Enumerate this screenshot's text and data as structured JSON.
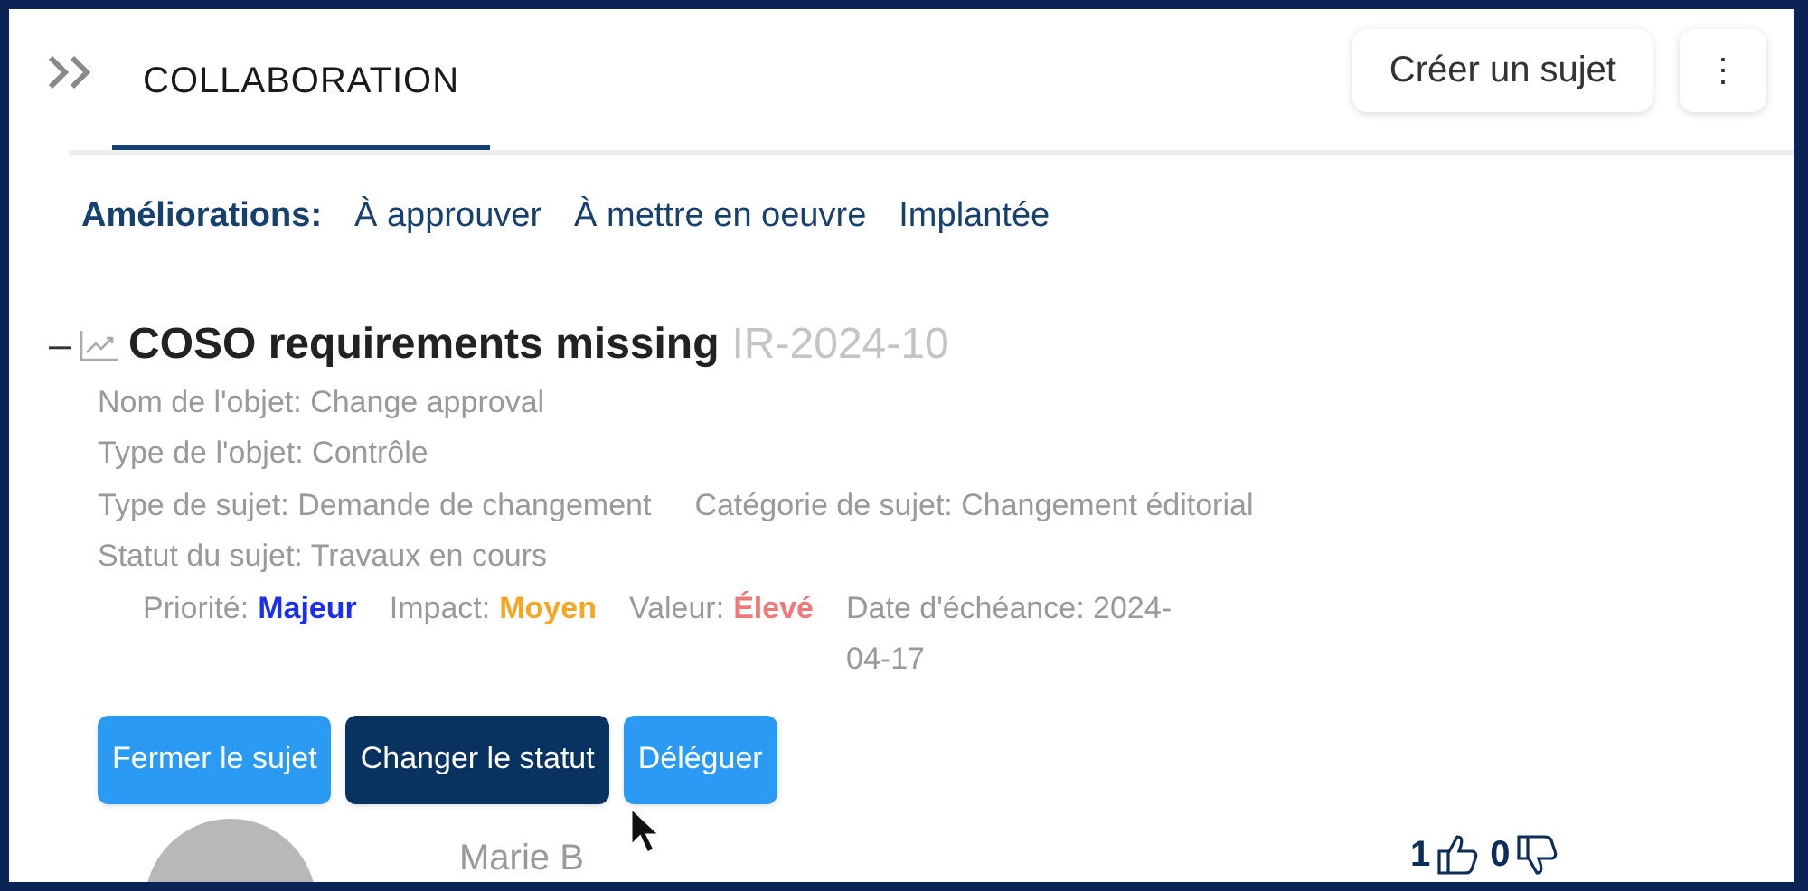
{
  "tabs": [
    {
      "label": "COLLABORATION",
      "selected": true
    }
  ],
  "header_buttons": [
    {
      "kind": "text",
      "label": "Créer un sujet"
    },
    {
      "kind": "menu",
      "label": "⋮"
    }
  ],
  "filters": {
    "label": "Améliorations:",
    "items": [
      {
        "label": "À approuver"
      },
      {
        "label": "À mettre en oeuvre"
      },
      {
        "label": "Implantée"
      }
    ]
  },
  "issue": {
    "expanded": true,
    "toggle": "–",
    "title": "COSO requirements missing",
    "id": "IR-2024-10",
    "fields": [
      [
        {
          "label": "Nom de l'objet:",
          "value": "Change approval"
        }
      ],
      [
        {
          "label": "Type de l'objet:",
          "value": "Contrôle"
        }
      ],
      [
        {
          "label": "Type de sujet:",
          "value": "Demande de changement"
        },
        {
          "label": "Catégorie de sujet:",
          "value": "Changement éditorial"
        }
      ],
      [
        {
          "label": "Statut du sujet:",
          "value": "Travaux en cours"
        }
      ]
    ],
    "meta": [
      {
        "label": "Priorité:",
        "value": "Majeur",
        "color": "#1a2ff0"
      },
      {
        "label": "Impact:",
        "value": "Moyen",
        "color": "#f5a623"
      },
      {
        "label": "Valeur:",
        "value": "Élevé",
        "color": "#f07878"
      },
      {
        "label": "Date d'échéance:",
        "value": "2024-04-17"
      }
    ],
    "actions": [
      {
        "label": "Fermer le sujet",
        "kind": "primary"
      },
      {
        "label": "Changer le statut",
        "kind": "dark"
      },
      {
        "label": "Déléguer",
        "kind": "primary"
      }
    ],
    "comment": {
      "author": "Marie B",
      "likes": "1",
      "dislikes": "0"
    }
  }
}
